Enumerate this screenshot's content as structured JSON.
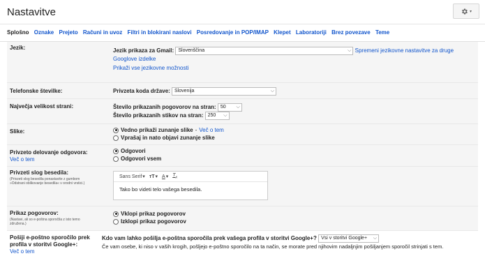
{
  "header": {
    "title": "Nastavitve",
    "gear_icon": "gear-icon"
  },
  "tabs": [
    {
      "label": "Splošno",
      "active": true
    },
    {
      "label": "Oznake"
    },
    {
      "label": "Prejeto"
    },
    {
      "label": "Računi in uvoz"
    },
    {
      "label": "Filtri in blokirani naslovi"
    },
    {
      "label": "Posredovanje in POP/IMAP"
    },
    {
      "label": "Klepet"
    },
    {
      "label": "Laboratoriji"
    },
    {
      "label": "Brez povezave"
    },
    {
      "label": "Teme"
    }
  ],
  "language": {
    "label": "Jezik:",
    "field_label": "Jezik prikaza za Gmail:",
    "selected": "Slovenščina",
    "change_link": "Spremeni jezikovne nastavitve za druge Googlove izdelke",
    "show_all_link": "Prikaži vse jezikovne možnosti"
  },
  "phone": {
    "label": "Telefonske številke:",
    "field_label": "Privzeta koda države:",
    "selected": "Slovenija"
  },
  "page_size": {
    "label": "Največja velikost strani:",
    "conv_label": "Število prikazanih pogovorov na stran:",
    "conv_value": "50",
    "contacts_label": "Število prikazanih stikov na stran:",
    "contacts_value": "250"
  },
  "images": {
    "label": "Slike:",
    "option1": "Vedno prikaži zunanje slike",
    "option1_link": "Več o tem",
    "option2": "Vprašaj in nato objavi zunanje slike",
    "selected": 0
  },
  "reply": {
    "label": "Privzeto delovanje odgovora:",
    "link": "Več o tem",
    "option1": "Odgovori",
    "option2": "Odgovori vsem",
    "selected": 0
  },
  "font": {
    "label": "Privzeti slog besedila:",
    "note": "(Privzeti slog besedila ponastavite z gumbom »Odstrani oblikovanje besedila« v orodni vrstici.)",
    "font_name": "Sans Serif",
    "size_icon": "text-size-icon",
    "color_icon": "text-color-icon",
    "clear_icon": "clear-format-icon",
    "preview": "Tako bo videti telo vašega besedila."
  },
  "conversation": {
    "label": "Prikaz pogovorov:",
    "note": "(Nastavi, ali so e-poštna sporočila z isto temo združena.)",
    "option1": "Vklopi prikaz pogovorov",
    "option2": "Izklopi prikaz pogovorov",
    "selected": 0
  },
  "profile": {
    "label": "Pošiji e-poštno sporočilo prek profila v storitvi Google+:",
    "link": "Več o tem",
    "question": "Kdo vam lahko pošilja e-poštna sporočila prek vašega profila v storitvi Google+?",
    "selected": "Vsi v storitvi Google+",
    "desc": "Če vam osebe, ki niso v vaših krogih, pošljejo e-poštno sporočilo na ta način, se morate pred njihovim nadaljnjim pošiljanjem sporočil strinjati s tem."
  }
}
